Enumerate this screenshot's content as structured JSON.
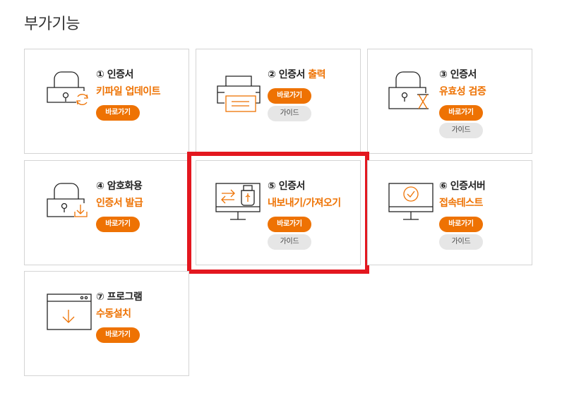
{
  "section_title": "부가기능",
  "colors": {
    "accent": "#ee7203",
    "highlight": "#e3171f",
    "border": "#d4d4d4"
  },
  "cards": [
    {
      "title": "① 인증서",
      "title_accent": "",
      "subtitle": "키파일 업데이트",
      "icon": "lock-refresh-icon",
      "go_label": "바로가기",
      "guide_label": ""
    },
    {
      "title": "② 인증서 ",
      "title_accent": "출력",
      "subtitle": "",
      "icon": "printer-icon",
      "go_label": "바로가기",
      "guide_label": "가이드"
    },
    {
      "title": "③ 인증서",
      "title_accent": "",
      "subtitle": "유효성 검증",
      "icon": "lock-hourglass-icon",
      "go_label": "바로가기",
      "guide_label": "가이드"
    },
    {
      "title": "④ 암호화용",
      "title_accent": "",
      "subtitle": "인증서 발급",
      "icon": "lock-download-icon",
      "go_label": "바로가기",
      "guide_label": ""
    },
    {
      "title": "⑤ 인증서",
      "title_accent": "",
      "subtitle": "내보내기/가져오기",
      "icon": "monitor-usb-icon",
      "go_label": "바로가기",
      "guide_label": "가이드"
    },
    {
      "title": "⑥ 인증서버",
      "title_accent": "",
      "subtitle": "접속테스트",
      "icon": "monitor-check-icon",
      "go_label": "바로가기",
      "guide_label": "가이드"
    },
    {
      "title": "⑦ 프로그램",
      "title_accent": "",
      "subtitle": "수동설치",
      "icon": "window-download-icon",
      "go_label": "바로가기",
      "guide_label": ""
    }
  ]
}
